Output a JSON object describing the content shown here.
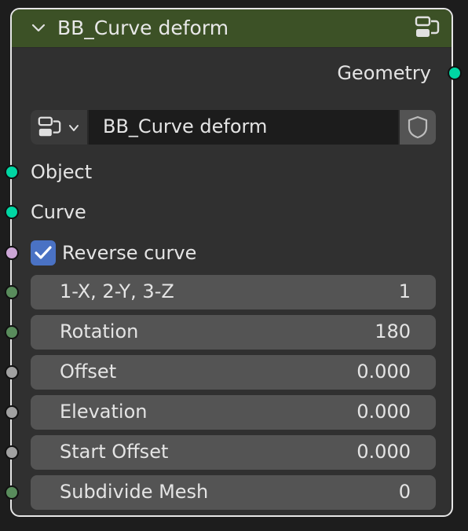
{
  "node": {
    "title": "BB_Curve deform",
    "header_color": "#3c5126",
    "collapse_icon": "chevron-down-icon",
    "group_icon": "node-group-icon"
  },
  "output": {
    "label": "Geometry",
    "socket_color": "#00d6a3"
  },
  "group_selector": {
    "icon": "node-group-icon",
    "name": "BB_Curve deform",
    "fake_user_icon": "shield-icon"
  },
  "inputs": {
    "object": {
      "label": "Object",
      "socket_color": "#00d6a3"
    },
    "curve": {
      "label": "Curve",
      "socket_color": "#00d6a3"
    },
    "reverse": {
      "label": "Reverse curve",
      "checked": true,
      "socket_color": "#cca6d6"
    }
  },
  "fields": [
    {
      "label": "1-X, 2-Y, 3-Z",
      "value": "1",
      "socket_color": "#598c5c"
    },
    {
      "label": "Rotation",
      "value": "180",
      "socket_color": "#598c5c"
    },
    {
      "label": "Offset",
      "value": "0.000",
      "socket_color": "#a1a1a1"
    },
    {
      "label": "Elevation",
      "value": "0.000",
      "socket_color": "#a1a1a1"
    },
    {
      "label": "Start Offset",
      "value": "0.000",
      "socket_color": "#a1a1a1"
    },
    {
      "label": "Subdivide Mesh",
      "value": "0",
      "socket_color": "#598c5c"
    }
  ]
}
